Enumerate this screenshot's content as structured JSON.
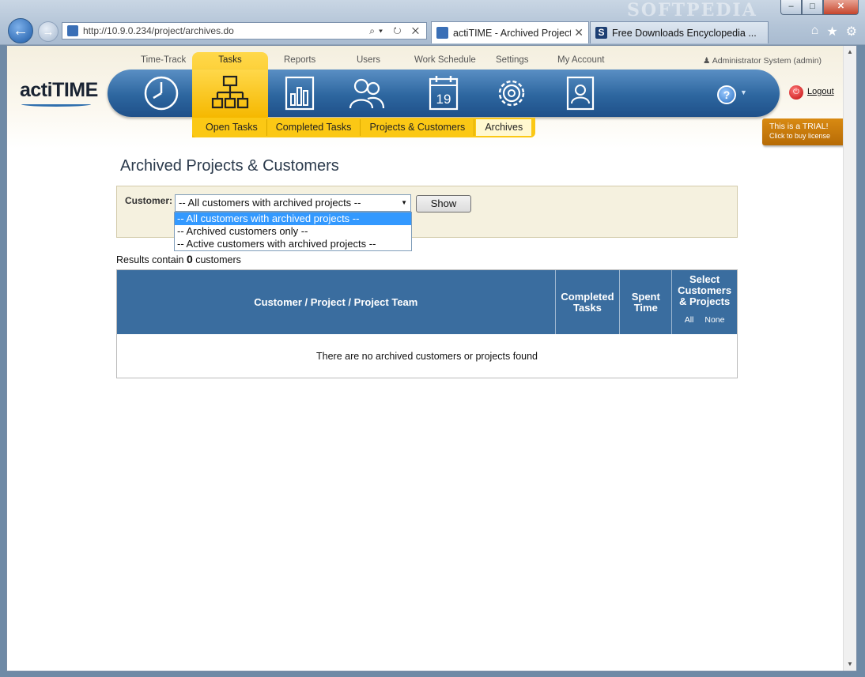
{
  "browser": {
    "window_buttons": {
      "minimize": "–",
      "maximize": "□",
      "close": "✕"
    },
    "back_icon": "arrow-left-icon",
    "forward_icon": "arrow-right-icon",
    "address": "http://10.9.0.234/project/archives.do",
    "address_tools": "⌕▾ ↻ ✕",
    "tabs": [
      {
        "title": "actiTIME - Archived Project...",
        "active": true
      },
      {
        "title": "Free Downloads Encyclopedia ...",
        "active": false,
        "icon_letter": "S"
      }
    ],
    "tab_close": "✕",
    "right_icons": {
      "home": "⌂",
      "favorites": "★",
      "tools": "⚙"
    },
    "watermark": "SOFTPEDIA"
  },
  "app": {
    "logo": "actiTIME",
    "top_nav": [
      "Time-Track",
      "Tasks",
      "Reports",
      "Users",
      "Work Schedule",
      "Settings",
      "My Account"
    ],
    "active_top": "Tasks",
    "user": "Administrator System (admin)",
    "sub_nav": [
      "Open Tasks",
      "Completed Tasks",
      "Projects & Customers",
      "Archives"
    ],
    "active_sub": "Archives",
    "help": "?",
    "logout": "Logout",
    "trial_line1": "This is a TRIAL!",
    "trial_line2": "Click to buy license",
    "colors": {
      "accent": "#f5b800",
      "bar": "#2d669f",
      "table_header": "#3a6d9f",
      "trial": "#c9770b"
    }
  },
  "content": {
    "title": "Archived Projects & Customers",
    "customer_label": "Customer:",
    "select_value": "-- All customers with archived projects --",
    "select_options": [
      "-- All customers with archived projects --",
      "-- Archived customers only --",
      "-- Active customers with archived projects --"
    ],
    "show_button": "Show",
    "results_prefix": "Results contain",
    "results_count": "0",
    "results_suffix": "customers",
    "table": {
      "col1": "Customer / Project / Project Team",
      "col2_l1": "Completed",
      "col2_l2": "Tasks",
      "col3_l1": "Spent",
      "col3_l2": "Time",
      "col4_l1": "Select",
      "col4_l2": "Customers",
      "col4_l3": "& Projects",
      "all": "All",
      "none": "None",
      "empty": "There are no archived customers or projects found"
    }
  }
}
